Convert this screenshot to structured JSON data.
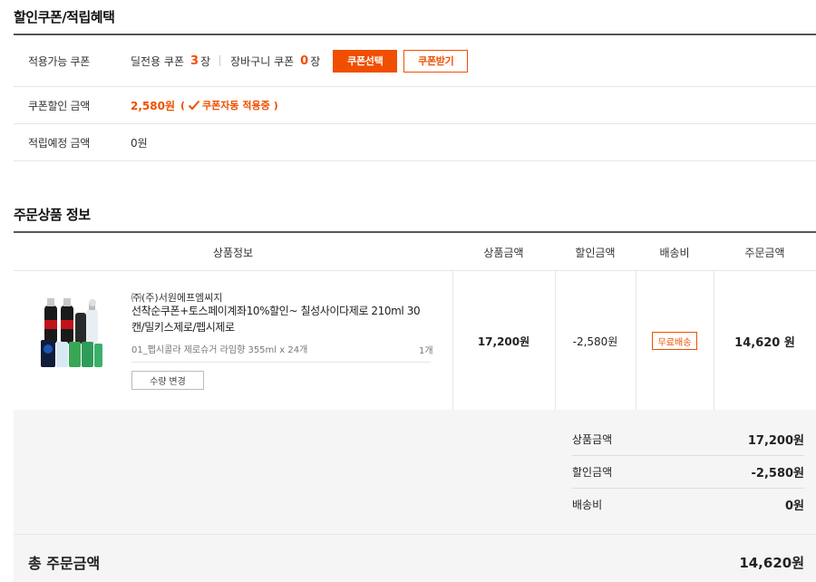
{
  "benefits": {
    "title": "할인쿠폰/적립혜택",
    "coupon_row": {
      "label": "적용가능 쿠폰",
      "deal_coupon_label": "딜전용 쿠폰",
      "deal_coupon_count": "3",
      "deal_coupon_unit": "장",
      "cart_coupon_label": "장바구니 쿠폰",
      "cart_coupon_count": "0",
      "cart_coupon_unit": "장",
      "select_button": "쿠폰선택",
      "receive_button": "쿠폰받기"
    },
    "discount_row": {
      "label": "쿠폰할인 금액",
      "amount": "2,580원",
      "paren_open": "(",
      "note": "쿠폰자동 적용중",
      "paren_close": ")"
    },
    "points_row": {
      "label": "적립예정 금액",
      "amount": "0원"
    }
  },
  "order": {
    "title": "주문상품 정보",
    "columns": [
      "상품정보",
      "상품금액",
      "할인금액",
      "배송비",
      "주문금액"
    ],
    "item": {
      "seller": "㈜(주)서원에프엠씨지",
      "name": "선착순쿠폰+토스페이계좌10%할인~ 칠성사이다제로 210ml 30캔/밀키스제로/펩시제로",
      "option": "01_펩시콜라 제로슈거 라임향 355ml x 24개",
      "quantity": "1개",
      "qty_change_button": "수량 변경",
      "price": "17,200원",
      "discount": "-2,580원",
      "shipping": "무료배송",
      "order_amount": "14,620 원"
    }
  },
  "summary": {
    "rows": [
      {
        "label": "상품금액",
        "value": "17,200원"
      },
      {
        "label": "할인금액",
        "value": "-2,580원"
      },
      {
        "label": "배송비",
        "value": "0원"
      }
    ],
    "total_label": "총 주문금액",
    "total_value": "14,620원"
  },
  "colors": {
    "accent": "#f04f00",
    "summary_bg": "#f5f5f5"
  }
}
